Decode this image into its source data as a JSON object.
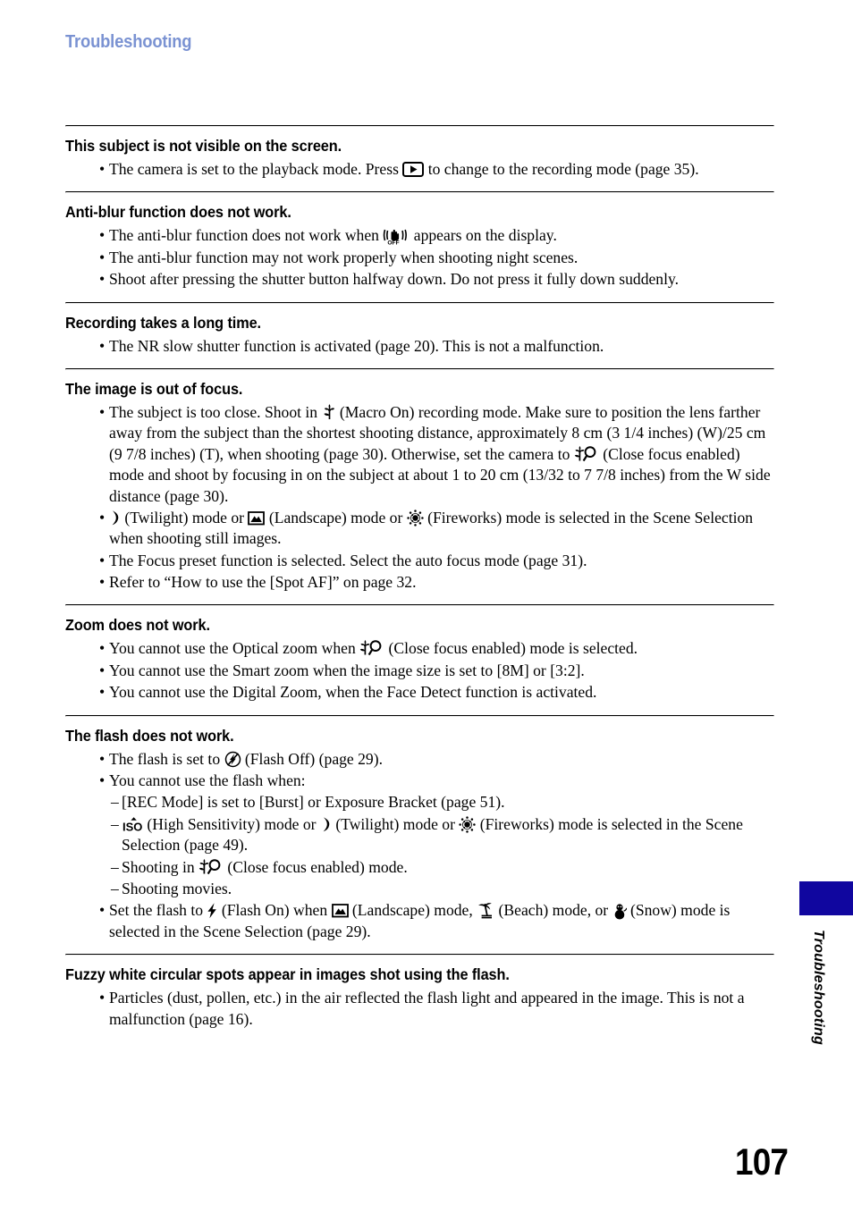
{
  "running_head": "Troubleshooting",
  "page_number": "107",
  "side_tab": {
    "label": "Troubleshooting",
    "color": "#10069f"
  },
  "accent_color": "#7a92d2",
  "sections": [
    {
      "title": "This subject is not visible on the screen.",
      "items": [
        {
          "marker": "•",
          "parts": [
            {
              "t": "text",
              "v": "The camera is set to the playback mode. Press "
            },
            {
              "t": "icon",
              "v": "playback-button-icon"
            },
            {
              "t": "text",
              "v": " to change to the recording mode (page 35)."
            }
          ]
        }
      ]
    },
    {
      "title": "Anti-blur function does not work.",
      "items": [
        {
          "marker": "•",
          "parts": [
            {
              "t": "text",
              "v": "The anti-blur function does not work when "
            },
            {
              "t": "icon",
              "v": "anti-blur-off-icon"
            },
            {
              "t": "text",
              "v": " appears on the display."
            }
          ]
        },
        {
          "marker": "•",
          "parts": [
            {
              "t": "text",
              "v": "The anti-blur function may not work properly when shooting night scenes."
            }
          ]
        },
        {
          "marker": "•",
          "parts": [
            {
              "t": "text",
              "v": "Shoot after pressing the shutter button halfway down. Do not press it fully down suddenly."
            }
          ]
        }
      ]
    },
    {
      "title": "Recording takes a long time.",
      "items": [
        {
          "marker": "•",
          "parts": [
            {
              "t": "text",
              "v": "The NR slow shutter function is activated (page 20). This is not a malfunction."
            }
          ]
        }
      ]
    },
    {
      "title": "The image is out of focus.",
      "items": [
        {
          "marker": "•",
          "parts": [
            {
              "t": "text",
              "v": "The subject is too close. Shoot in "
            },
            {
              "t": "icon",
              "v": "macro-on-icon"
            },
            {
              "t": "text",
              "v": " (Macro On) recording mode. Make sure to position the lens farther away from the subject than the shortest shooting distance, approximately 8 cm (3 1/4 inches) (W)/25 cm (9 7/8 inches) (T), when shooting (page 30). Otherwise, set the camera to "
            },
            {
              "t": "icon",
              "v": "close-focus-icon"
            },
            {
              "t": "text",
              "v": " (Close focus enabled) mode and shoot by focusing in on the subject at about 1 to 20 cm (13/32 to 7 7/8 inches) from the W side distance (page 30)."
            }
          ]
        },
        {
          "marker": "•",
          "parts": [
            {
              "t": "icon",
              "v": "twilight-icon"
            },
            {
              "t": "text",
              "v": " (Twilight) mode or "
            },
            {
              "t": "icon",
              "v": "landscape-icon"
            },
            {
              "t": "text",
              "v": " (Landscape) mode or "
            },
            {
              "t": "icon",
              "v": "fireworks-icon"
            },
            {
              "t": "text",
              "v": " (Fireworks) mode is selected in the Scene Selection when shooting still images."
            }
          ]
        },
        {
          "marker": "•",
          "parts": [
            {
              "t": "text",
              "v": "The Focus preset function is selected. Select the auto focus mode (page 31)."
            }
          ]
        },
        {
          "marker": "•",
          "parts": [
            {
              "t": "text",
              "v": "Refer to “How to use the [Spot AF]” on page 32."
            }
          ]
        }
      ]
    },
    {
      "title": "Zoom does not work.",
      "items": [
        {
          "marker": "•",
          "parts": [
            {
              "t": "text",
              "v": "You cannot use the Optical zoom when "
            },
            {
              "t": "icon",
              "v": "close-focus-icon"
            },
            {
              "t": "text",
              "v": " (Close focus enabled) mode is selected."
            }
          ]
        },
        {
          "marker": "•",
          "parts": [
            {
              "t": "text",
              "v": "You cannot use the Smart zoom when the image size is set to [8M] or [3:2]."
            }
          ]
        },
        {
          "marker": "•",
          "parts": [
            {
              "t": "text",
              "v": "You cannot use the Digital Zoom, when the Face Detect function is activated."
            }
          ]
        }
      ]
    },
    {
      "title": "The flash does not work.",
      "items": [
        {
          "marker": "•",
          "parts": [
            {
              "t": "text",
              "v": "The flash is set to "
            },
            {
              "t": "icon",
              "v": "flash-off-icon"
            },
            {
              "t": "text",
              "v": " (Flash Off) (page 29)."
            }
          ]
        },
        {
          "marker": "•",
          "parts": [
            {
              "t": "text",
              "v": "You cannot use the flash when:"
            }
          ]
        },
        {
          "marker": "–",
          "dash": true,
          "parts": [
            {
              "t": "text",
              "v": "[REC Mode] is set to [Burst] or Exposure Bracket (page 51)."
            }
          ]
        },
        {
          "marker": "–",
          "dash": true,
          "parts": [
            {
              "t": "icon",
              "v": "high-sensitivity-icon"
            },
            {
              "t": "text",
              "v": " (High Sensitivity) mode or "
            },
            {
              "t": "icon",
              "v": "twilight-icon"
            },
            {
              "t": "text",
              "v": " (Twilight) mode or "
            },
            {
              "t": "icon",
              "v": "fireworks-icon"
            },
            {
              "t": "text",
              "v": " (Fireworks) mode is selected in the Scene Selection (page 49)."
            }
          ]
        },
        {
          "marker": "–",
          "dash": true,
          "parts": [
            {
              "t": "text",
              "v": "Shooting in "
            },
            {
              "t": "icon",
              "v": "close-focus-icon"
            },
            {
              "t": "text",
              "v": " (Close focus enabled) mode."
            }
          ]
        },
        {
          "marker": "–",
          "dash": true,
          "parts": [
            {
              "t": "text",
              "v": "Shooting movies."
            }
          ]
        },
        {
          "marker": "•",
          "parts": [
            {
              "t": "text",
              "v": "Set the flash to "
            },
            {
              "t": "icon",
              "v": "flash-on-icon"
            },
            {
              "t": "text",
              "v": " (Flash On) when "
            },
            {
              "t": "icon",
              "v": "landscape-icon"
            },
            {
              "t": "text",
              "v": " (Landscape) mode, "
            },
            {
              "t": "icon",
              "v": "beach-icon"
            },
            {
              "t": "text",
              "v": " (Beach) mode, or "
            },
            {
              "t": "icon",
              "v": "snow-icon"
            },
            {
              "t": "text",
              "v": " (Snow) mode is selected in the Scene Selection (page 29)."
            }
          ]
        }
      ]
    },
    {
      "title": "Fuzzy white circular spots appear in images shot using the flash.",
      "items": [
        {
          "marker": "•",
          "parts": [
            {
              "t": "text",
              "v": "Particles (dust, pollen, etc.) in the air reflected the flash light and appeared in the image. This is not a malfunction (page 16)."
            }
          ]
        }
      ]
    }
  ]
}
